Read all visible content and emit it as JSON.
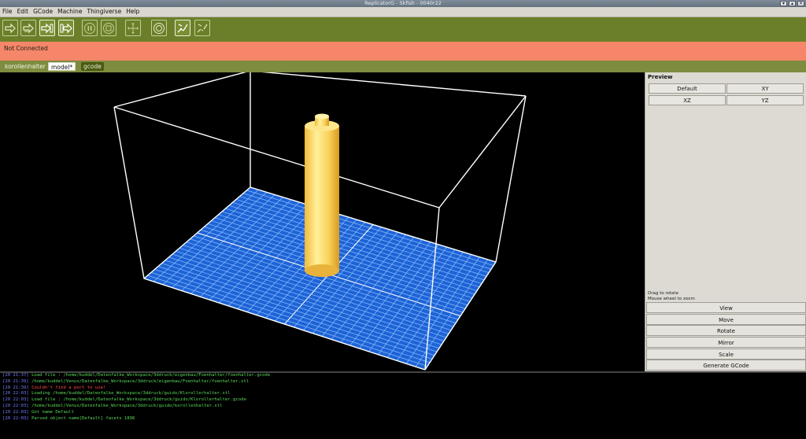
{
  "window": {
    "title": "ReplicatorG - Skfish - 0040r22"
  },
  "menu": [
    "File",
    "Edit",
    "GCode",
    "Machine",
    "Thingiverse",
    "Help"
  ],
  "toolbar": {
    "buttons": [
      {
        "name": "build-button",
        "icon": "build-icon"
      },
      {
        "name": "upload-button",
        "icon": "upload-icon"
      },
      {
        "name": "build-to-file-button",
        "icon": "build-to-file-icon"
      },
      {
        "name": "build-from-file-button",
        "icon": "build-from-file-icon"
      },
      {
        "name": "pause-button",
        "icon": "pause-icon"
      },
      {
        "name": "stop-button",
        "icon": "stop-icon"
      },
      {
        "name": "control-panel-button",
        "icon": "control-panel-icon"
      },
      {
        "name": "reset-button",
        "icon": "reset-icon"
      },
      {
        "name": "connect-button",
        "icon": "connect-icon"
      },
      {
        "name": "disconnect-button",
        "icon": "disconnect-icon"
      }
    ]
  },
  "status": {
    "text": "Not Connected",
    "color": "#f6866a"
  },
  "tabs": [
    {
      "label": "korollenhalter",
      "state": "inactive"
    },
    {
      "label": "model*",
      "state": "active"
    },
    {
      "label": "gcode",
      "state": "dark"
    }
  ],
  "preview": {
    "title": "Preview",
    "views": [
      "Default",
      "XY",
      "XZ",
      "YZ"
    ],
    "hint_line1": "Drag to rotate",
    "hint_line2": "Mouse wheel to zoom",
    "actions": [
      "View",
      "Move",
      "Rotate",
      "Mirror",
      "Scale",
      "Generate GCode"
    ]
  },
  "console": {
    "lines": [
      {
        "time": "[20 21:37]",
        "text": "Load file : /home/kuddel/Datenfalke_Workspace/3ddruck/eigenbau/Foenhalter/foenhalter.gcode",
        "color": "#58d858"
      },
      {
        "time": "[20 21:39]",
        "text": "/home/kuddel/Venus/Datenfalke_Workspace/3ddruck/eigenbau/Foenhalter/foenhalter.stl",
        "color": "#58d858"
      },
      {
        "time": "[20 21:39]",
        "text": "Couldn't find a port to use!",
        "color": "#ff4c4c"
      },
      {
        "time": "[20 22:03]",
        "text": "Loading /home/kuddel/Datenfalke_Workspace/3ddruck/guido/Klorollerhalter.stl",
        "color": "#58d858"
      },
      {
        "time": "[20 22:03]",
        "text": "Load file : /home/kuddel/Datenfalke_Workspace/3ddruck/guido/Klorollerhalter.gcode",
        "color": "#58d858"
      },
      {
        "time": "[20 22:03]",
        "text": "/home/kuddel/Venus/Datenfalke_Workspace/3ddruck/guido/korollenhalter.stl",
        "color": "#58d858"
      },
      {
        "time": "[20 22:03]",
        "text": "Got name Default",
        "color": "#58d858"
      },
      {
        "time": "[20 22:03]",
        "text": "Parsed object name[Default] facets 1896",
        "color": "#58d858"
      }
    ]
  },
  "colors": {
    "toolbar": "#6b7f2a",
    "tabstrip": "#7d8c3e",
    "build_plate": "#1e63d6",
    "model": "#f6c94a",
    "bounding_box": "#ffffff"
  }
}
